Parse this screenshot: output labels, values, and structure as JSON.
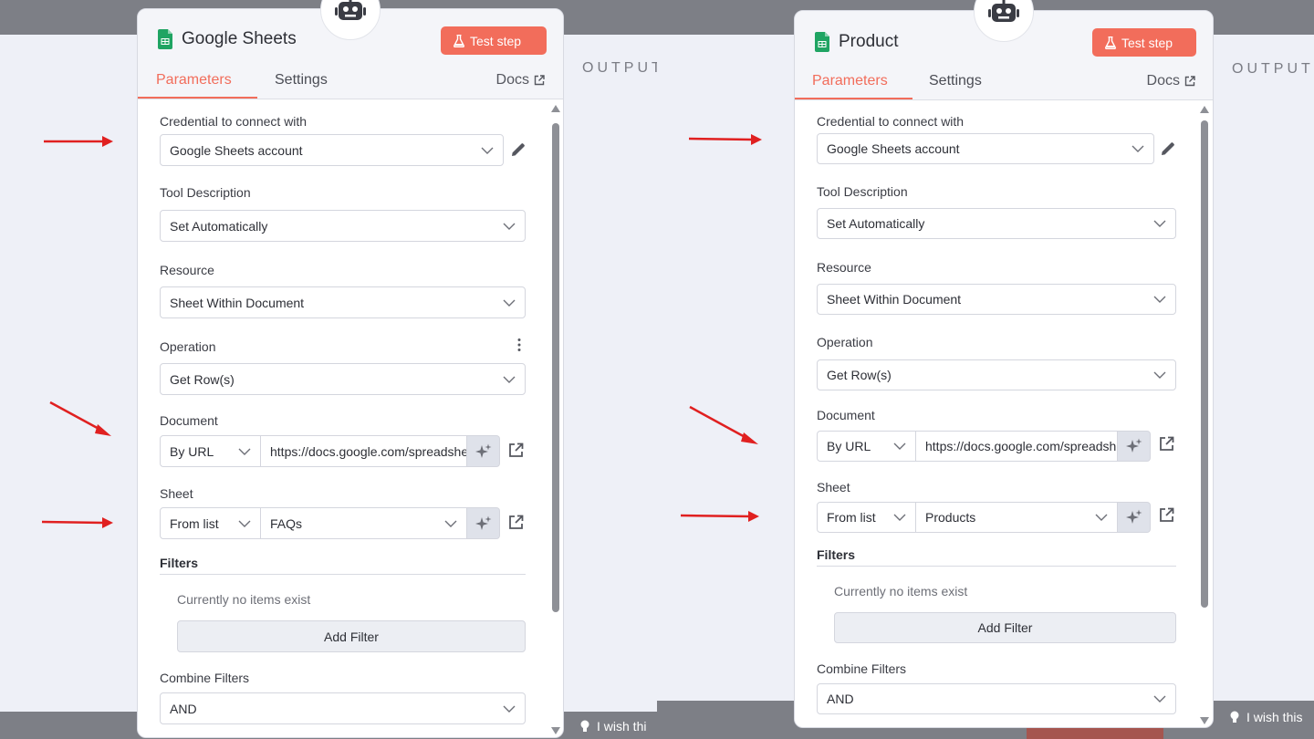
{
  "left": {
    "output_label": "OUTPUT",
    "wish_text": "I wish thi",
    "panel": {
      "title": "Google Sheets",
      "test_step_label": "Test step",
      "tabs": [
        {
          "label": "Parameters",
          "active": true
        },
        {
          "label": "Settings",
          "active": false
        }
      ],
      "docs_label": "Docs",
      "fields": {
        "credential": {
          "label": "Credential to connect with",
          "value": "Google Sheets account"
        },
        "tool_description": {
          "label": "Tool Description",
          "value": "Set Automatically"
        },
        "resource": {
          "label": "Resource",
          "value": "Sheet Within Document"
        },
        "operation": {
          "label": "Operation",
          "value": "Get Row(s)"
        },
        "document": {
          "label": "Document",
          "mode": "By URL",
          "value": "https://docs.google.com/spreadsheets"
        },
        "sheet": {
          "label": "Sheet",
          "mode": "From list",
          "value": "FAQs"
        },
        "filters": {
          "label": "Filters",
          "empty_text": "Currently no items exist",
          "add_label": "Add Filter"
        },
        "combine_filters": {
          "label": "Combine Filters",
          "value": "AND"
        }
      }
    }
  },
  "right": {
    "output_label": "OUTPUT",
    "wish_text": "I wish this",
    "panel": {
      "title": "Product",
      "test_step_label": "Test step",
      "tabs": [
        {
          "label": "Parameters",
          "active": true
        },
        {
          "label": "Settings",
          "active": false
        }
      ],
      "docs_label": "Docs",
      "fields": {
        "credential": {
          "label": "Credential to connect with",
          "value": "Google Sheets account"
        },
        "tool_description": {
          "label": "Tool Description",
          "value": "Set Automatically"
        },
        "resource": {
          "label": "Resource",
          "value": "Sheet Within Document"
        },
        "operation": {
          "label": "Operation",
          "value": "Get Row(s)"
        },
        "document": {
          "label": "Document",
          "mode": "By URL",
          "value": "https://docs.google.com/spreadsheets"
        },
        "sheet": {
          "label": "Sheet",
          "mode": "From list",
          "value": "Products"
        },
        "filters": {
          "label": "Filters",
          "empty_text": "Currently no items exist",
          "add_label": "Add Filter"
        },
        "combine_filters": {
          "label": "Combine Filters",
          "value": "AND"
        }
      }
    }
  },
  "colors": {
    "accent": "#f26d5b",
    "annotation_arrow": "#e02020",
    "sheets_green": "#1fa463"
  },
  "icons": [
    "robot-icon",
    "google-sheets-icon",
    "flask-icon",
    "external-link-icon",
    "chevron-down-icon",
    "pencil-icon",
    "kebab-menu-icon",
    "sparkle-icon",
    "lightbulb-icon",
    "red-arrow"
  ]
}
